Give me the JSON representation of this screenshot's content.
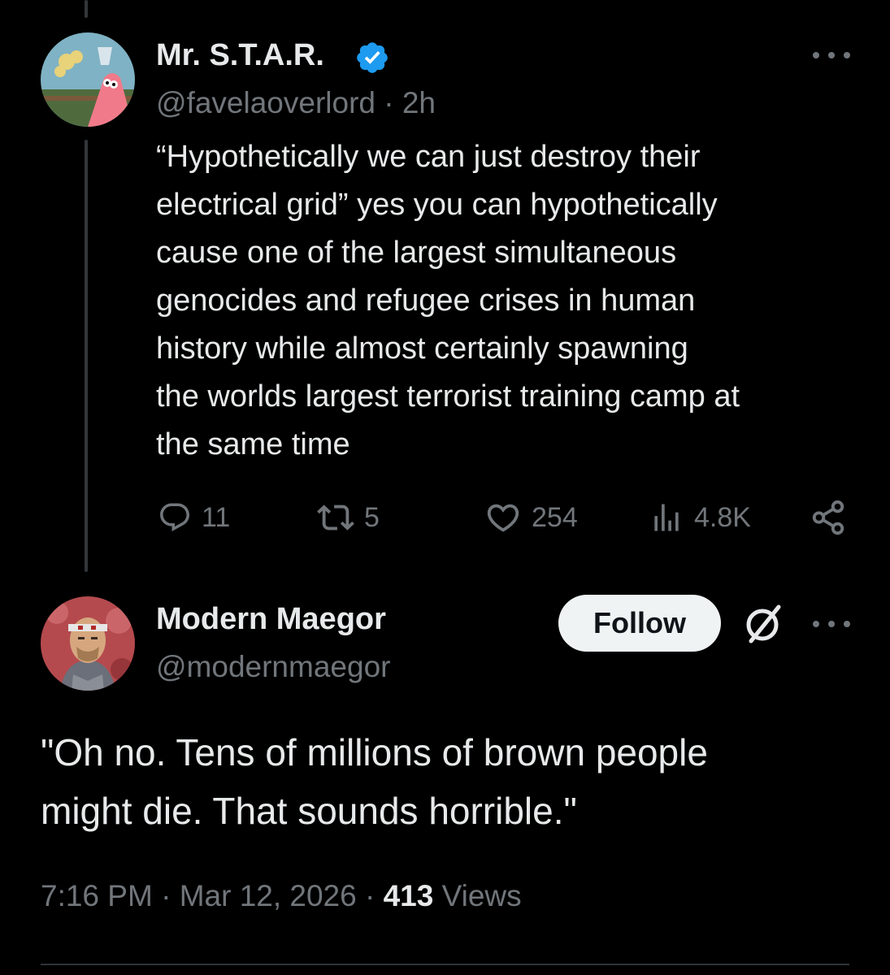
{
  "original_tweet": {
    "display_name": "Mr. S.T.A.R.",
    "handle": "@favelaoverlord",
    "separator": "·",
    "time": "2h",
    "verified": true,
    "text": "“Hypothetically we can just destroy their\nelectrical grid” yes you can hypothetically\ncause one of the largest simultaneous\ngenocides and refugee crises in human\nhistory while almost certainly spawning\nthe worlds largest terrorist training camp at\nthe same time",
    "replies": "11",
    "reposts": "5",
    "likes": "254",
    "views": "4.8K"
  },
  "reply_tweet": {
    "display_name": "Modern Maegor",
    "handle": "@modernmaegor",
    "follow_label": "Follow",
    "text": "\"Oh no. Tens of millions of brown people\nmight die. That sounds horrible.\"",
    "time": "7:16 PM",
    "separator": "·",
    "date": "Mar 12, 2026",
    "views_count": "413",
    "views_label": "Views"
  },
  "colors": {
    "background": "#000000",
    "text": "#e7e9ea",
    "secondary": "#71767b",
    "verified": "#1d9bf0",
    "follow_bg": "#eff3f4"
  },
  "icons": [
    "verified-badge-icon",
    "more-icon",
    "reply-icon",
    "repost-icon",
    "like-icon",
    "views-icon",
    "share-icon",
    "grok-icon"
  ]
}
